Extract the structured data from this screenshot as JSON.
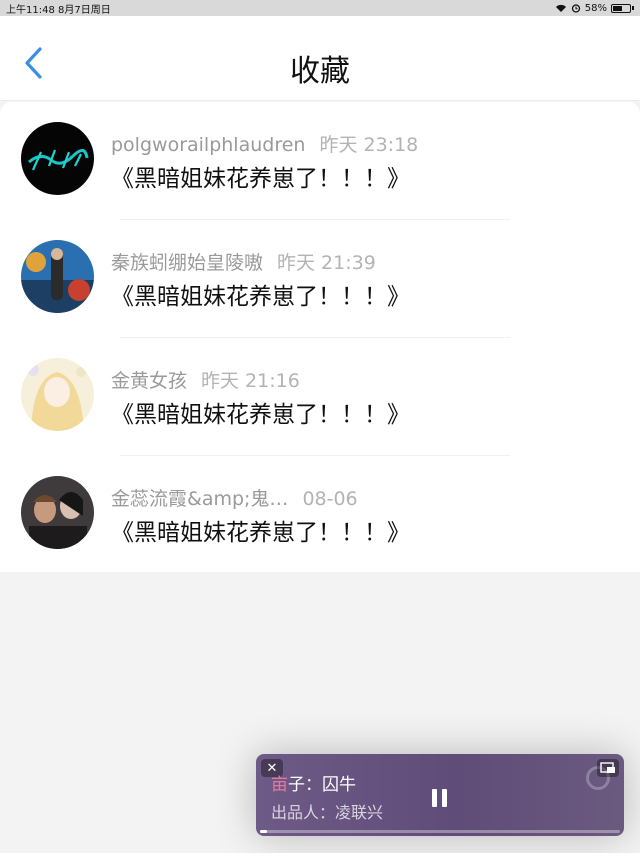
{
  "status_bar": {
    "time_date": "上午11:48   8月7日周日",
    "battery": "58%",
    "battery_level": 0.58
  },
  "header": {
    "title": "收藏",
    "back_icon": "chevron-left-icon",
    "accent_color": "#3a8ee6"
  },
  "favorites": [
    {
      "user": "polgworailphlaudren",
      "time": "昨天 23:18",
      "content": "《黑暗姐妹花养崽了！！！》"
    },
    {
      "user": "秦族蚓绷始皇陵嗷",
      "time": "昨天 21:39",
      "content": "《黑暗姐妹花养崽了！！！》"
    },
    {
      "user": "金黄女孩",
      "time": "昨天 21:16",
      "content": "《黑暗姐妹花养崽了！！！》"
    },
    {
      "user": "金蕊流霞&amp;鬼…",
      "time": "08-06",
      "content": "《黑暗姐妹花养崽了！！！》"
    }
  ],
  "player": {
    "song_accent": "亩",
    "song_rest": "子：囚牛",
    "producer": "出品人：凌联兴",
    "close_icon": "close-icon",
    "pause_icon": "pause-icon",
    "pip_icon": "picture-in-picture-icon",
    "progress": 0.02
  }
}
